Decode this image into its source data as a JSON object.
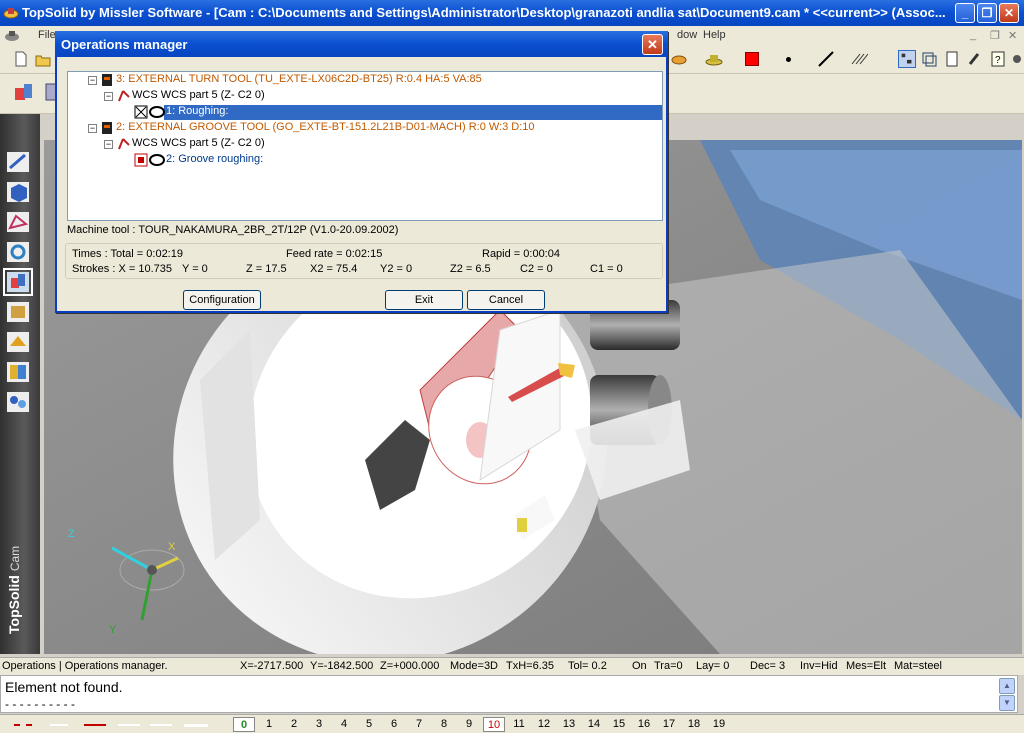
{
  "window": {
    "title": "TopSolid by Missler Software - [Cam : C:\\Documents and Settings\\Administrator\\Desktop\\granazoti andlia sat\\Document9.cam *  <<current>> (Assoc...",
    "minimize": "_",
    "restore": "❐",
    "close": "✕"
  },
  "menubar": {
    "items": [
      "File",
      "dow",
      "Help"
    ]
  },
  "dialog": {
    "title": "Operations manager",
    "close": "✕",
    "tree": {
      "tool1": "3: EXTERNAL TURN TOOL (TU_EXTE-LX06C2D-BT25)  R:0.4  HA:5  VA:85",
      "wcs1": "WCS WCS part 5 (Z-   C2 0)",
      "op1": "1: Roughing:",
      "tool2": "2: EXTERNAL GROOVE TOOL (GO_EXTE-BT-151.2L21B-D01-MACH)  R:0  W:3  D:10",
      "wcs2": "WCS WCS part 5 (Z-   C2 0)",
      "op2": "2: Groove roughing:",
      "expand_symbol": "−"
    },
    "machine_tool": "Machine tool : TOUR_NAKAMURA_2BR_2T/12P (V1.0-20.09.2002)",
    "times": {
      "total": "Times :  Total = 0:02:19",
      "feed": "Feed rate = 0:02:15",
      "rapid": "Rapid = 0:00:04"
    },
    "strokes": {
      "x": "Strokes :  X = 10.735",
      "y": "Y = 0",
      "z": "Z = 17.5",
      "x2": "X2 = 75.4",
      "y2": "Y2 = 0",
      "z2": "Z2 = 6.5",
      "c2": "C2 = 0",
      "c1": "C1 = 0"
    },
    "buttons": {
      "configuration": "Configuration",
      "exit": "Exit",
      "cancel": "Cancel"
    }
  },
  "brand": {
    "name": "TopSolid",
    "module": "Cam"
  },
  "axes": {
    "x": "X",
    "y": "Y",
    "z": "Z"
  },
  "statusbar": {
    "mode_text": "Operations | Operations manager.",
    "x": "X=-2717.500",
    "y": "Y=-1842.500",
    "z": "Z=+000.000",
    "mode": "Mode=3D",
    "txh": "TxH=6.35",
    "tol": "Tol=   0.2",
    "on": "On",
    "tra": "Tra=0",
    "lay": "Lay=  0",
    "dec": "Dec= 3",
    "inv": "Inv=Hid",
    "mes": "Mes=Elt",
    "mat": "Mat=steel"
  },
  "messages": {
    "line1": "Element not found.",
    "line2": "- - - - - - - - - -"
  },
  "layers": {
    "numbers": [
      "0",
      "1",
      "2",
      "3",
      "4",
      "5",
      "6",
      "7",
      "8",
      "9",
      "10",
      "11",
      "12",
      "13",
      "14",
      "15",
      "16",
      "17",
      "18",
      "19"
    ],
    "active": "0",
    "highlighted": "10"
  },
  "colors": {
    "titlebar": "#0a4fd0",
    "tool_text": "#c05a00",
    "selection": "#316ac5",
    "active_layer": "#2a8a2a",
    "highlighted_layer": "#cc0000"
  }
}
